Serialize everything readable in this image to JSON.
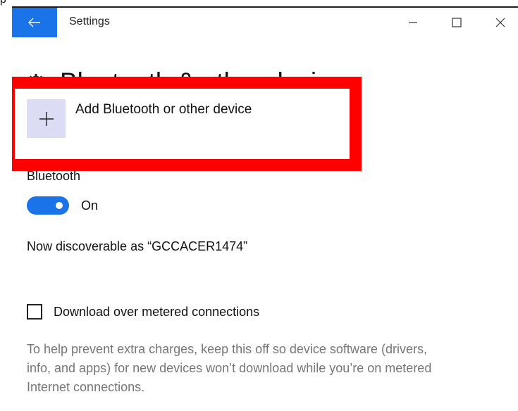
{
  "window": {
    "title": "Settings",
    "controls": {
      "minimize": "minimize-icon",
      "maximize": "maximize-icon",
      "close": "close-icon"
    },
    "back_icon": "back-arrow-icon"
  },
  "top_fragment": "p",
  "page": {
    "icon": "gear-icon",
    "title": "Bluetooth & other devices"
  },
  "add_device": {
    "icon": "plus-icon",
    "label": "Add Bluetooth or other device"
  },
  "bluetooth": {
    "heading": "Bluetooth",
    "toggle_on": true,
    "toggle_label": "On",
    "discoverable": "Now discoverable as “GCCACER1474”"
  },
  "metered": {
    "checked": false,
    "label": "Download over metered connections",
    "help": "To help prevent extra charges, keep this off so device software (drivers, info, and apps) for new devices won’t download while you’re on metered Internet connections."
  },
  "colors": {
    "accent": "#1a73e8",
    "highlight": "#ff0000",
    "plus_tile": "#dcdcf4",
    "secondary_text": "#767676"
  }
}
